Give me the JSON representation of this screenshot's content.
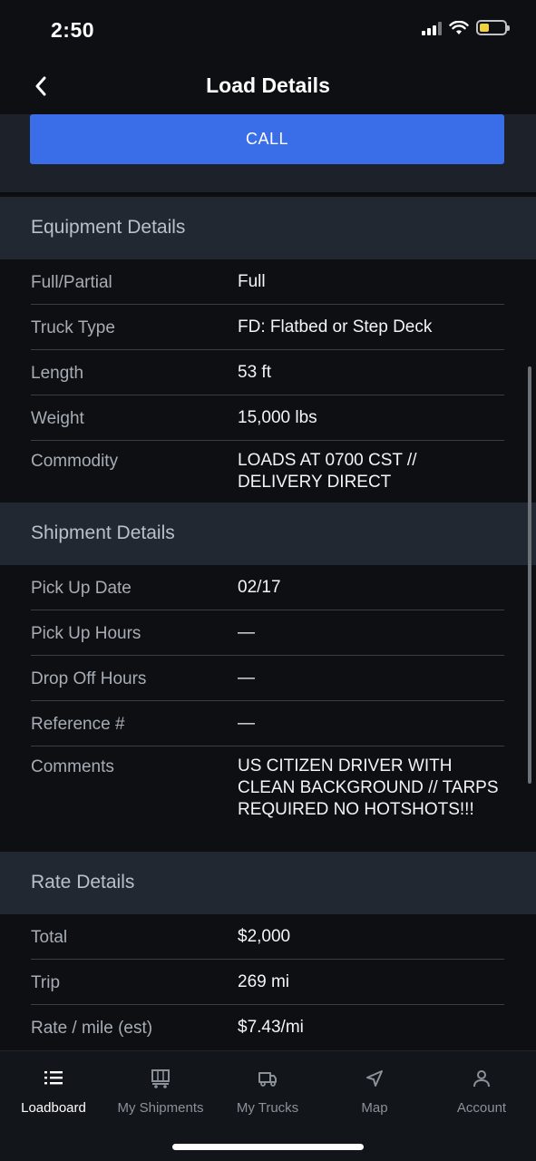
{
  "status_bar": {
    "time": "2:50"
  },
  "nav": {
    "title": "Load Details"
  },
  "call_button": "CALL",
  "equipment": {
    "header": "Equipment Details",
    "rows": [
      {
        "label": "Full/Partial",
        "value": "Full"
      },
      {
        "label": "Truck Type",
        "value": "FD: Flatbed or Step Deck"
      },
      {
        "label": "Length",
        "value": "53 ft"
      },
      {
        "label": "Weight",
        "value": "15,000 lbs"
      },
      {
        "label": "Commodity",
        "value": "LOADS AT 0700 CST // DELIVERY DIRECT"
      }
    ]
  },
  "shipment": {
    "header": "Shipment Details",
    "rows": [
      {
        "label": "Pick Up Date",
        "value": "02/17"
      },
      {
        "label": "Pick Up Hours",
        "value": "—"
      },
      {
        "label": "Drop Off Hours",
        "value": "—"
      },
      {
        "label": "Reference #",
        "value": "—"
      },
      {
        "label": "Comments",
        "value": "US CITIZEN DRIVER WITH CLEAN BACKGROUND // TARPS REQUIRED NO HOTSHOTS!!!"
      }
    ]
  },
  "rate": {
    "header": "Rate Details",
    "rows": [
      {
        "label": "Total",
        "value": "$2,000"
      },
      {
        "label": "Trip",
        "value": "269 mi"
      },
      {
        "label": "Rate / mile (est)",
        "value": "$7.43/mi"
      }
    ]
  },
  "tabs": [
    {
      "label": "Loadboard",
      "icon": "list-icon",
      "active": true
    },
    {
      "label": "My Shipments",
      "icon": "trailer-icon",
      "active": false
    },
    {
      "label": "My Trucks",
      "icon": "truck-icon",
      "active": false
    },
    {
      "label": "Map",
      "icon": "navigation-arrow-icon",
      "active": false
    },
    {
      "label": "Account",
      "icon": "user-icon",
      "active": false
    }
  ],
  "colors": {
    "accent": "#3a6de8",
    "section_bg": "#222831",
    "background": "#0d0f12",
    "battery": "#f2d23c"
  }
}
